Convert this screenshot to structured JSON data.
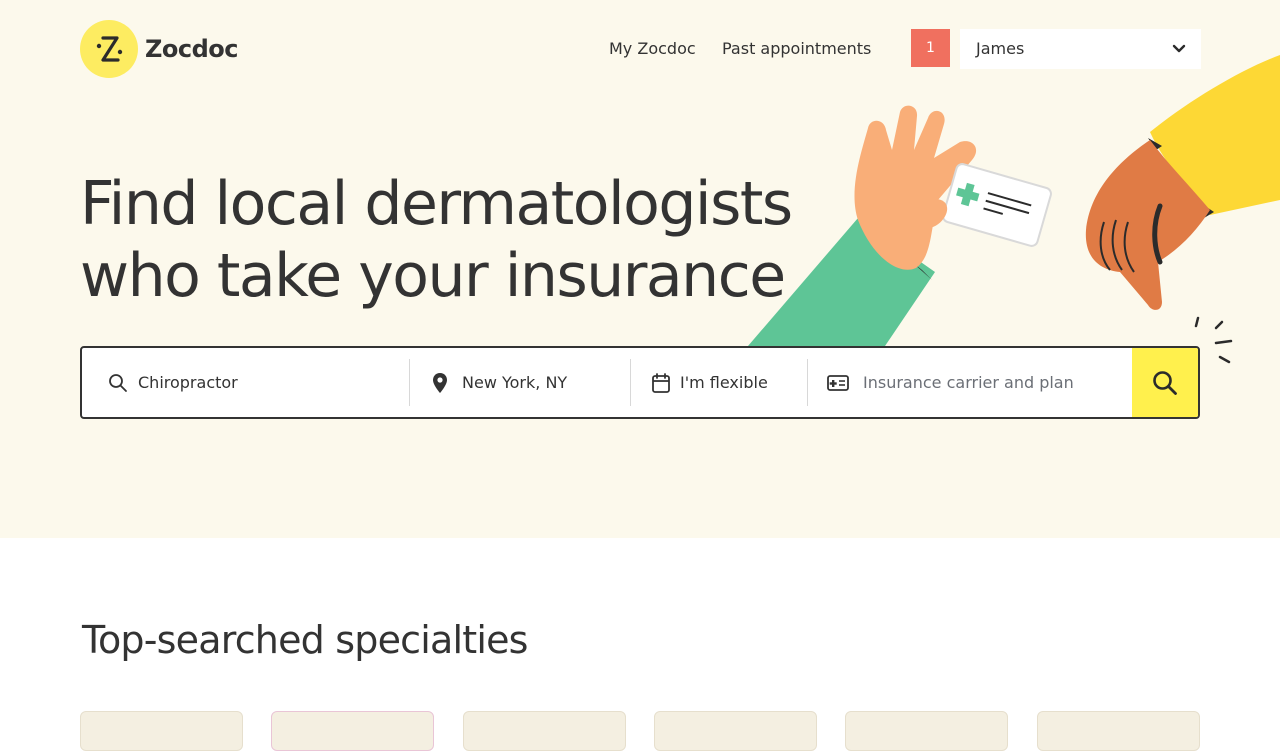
{
  "header": {
    "logo_text": "Zocdoc",
    "nav": {
      "my_zocdoc": "My Zocdoc",
      "past_appointments": "Past appointments"
    },
    "notification_count": "1",
    "user_name": "James"
  },
  "hero": {
    "headline_line1": "Find local dermatologists",
    "headline_line2": "who take your insurance"
  },
  "search": {
    "specialty_value": "Chiropractor",
    "location_value": "New York, NY",
    "date_value": "I'm flexible",
    "insurance_placeholder": "Insurance carrier and plan",
    "icons": {
      "specialty": "search-icon",
      "location": "location-pin-icon",
      "date": "calendar-icon",
      "insurance": "insurance-card-icon",
      "submit": "search-icon"
    }
  },
  "specialties_section": {
    "title": "Top-searched specialties"
  },
  "colors": {
    "hero_background": "#fcf9ec",
    "brand_yellow": "#fff04d",
    "logo_yellow": "#fdec61",
    "notification_badge": "#f0705f",
    "text_dark": "#333333",
    "card_beige": "#f4efe1"
  }
}
